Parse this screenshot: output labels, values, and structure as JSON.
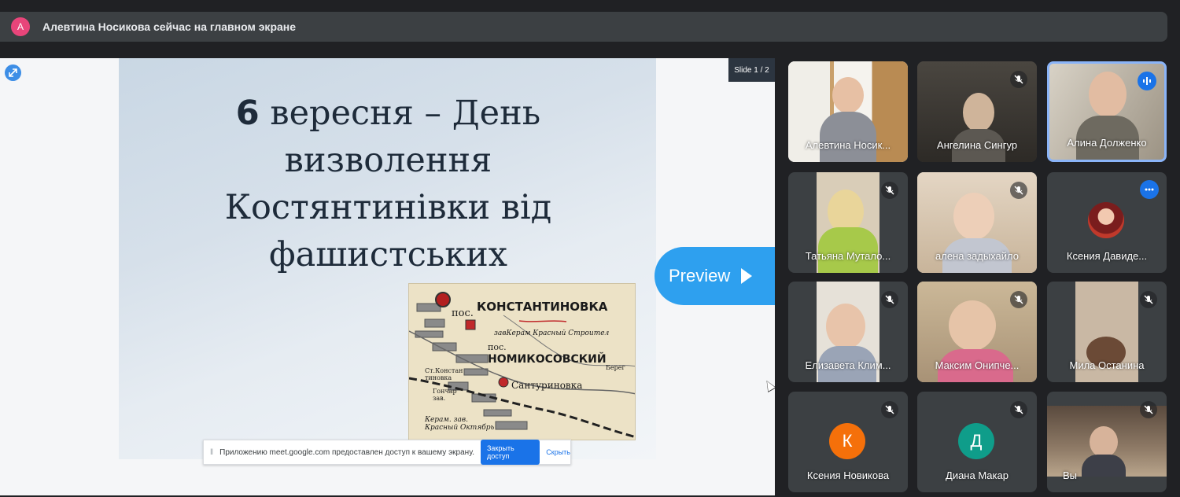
{
  "presenter_bar": {
    "avatar_letter": "А",
    "text": "Алевтина Носикова сейчас на главном экране"
  },
  "screen": {
    "slide_counter": "Slide 1 / 2",
    "slide": {
      "title_number": "6",
      "title_rest_line1": "вересня – День",
      "title_line2": "визволення",
      "title_line3": "Костянтинівки від",
      "title_line4": "фашистських"
    },
    "map_labels": {
      "posolok1": "пос.",
      "town": "КОНСТАНТИНОВКА",
      "line2": "завКерам Красный Строител",
      "posolok2": "пос.",
      "village": "НОМИКОСОВСКИЙ",
      "station": "Ст.Констан тиновка",
      "santurinovka": "Сантуриновка",
      "gonchar": "Гончар зав.",
      "keram": "Керам. зав. Красный Октябрь",
      "bereg": "Берег"
    },
    "preview_button": "Preview",
    "share_notice": {
      "message": "Приложению meet.google.com предоставлен доступ к вашему экрану.",
      "stop_button": "Закрыть доступ",
      "hide_link": "Скрыть"
    }
  },
  "participants": [
    {
      "name": "Алевтина Носик...",
      "muted": false,
      "speaking": false
    },
    {
      "name": "Ангелина Сингур",
      "muted": true,
      "speaking": false
    },
    {
      "name": "Алина Долженко",
      "muted": false,
      "speaking": true
    },
    {
      "name": "Татьяна Мутало...",
      "muted": true,
      "speaking": false
    },
    {
      "name": "алена задыхайло",
      "muted": true,
      "speaking": false
    },
    {
      "name": "Ксения Давиде...",
      "muted": false,
      "speaking": true
    },
    {
      "name": "Елизавета Клим...",
      "muted": true,
      "speaking": false
    },
    {
      "name": "Максим Онипче...",
      "muted": true,
      "speaking": false
    },
    {
      "name": "Мила Останина",
      "muted": true,
      "speaking": false
    },
    {
      "name": "Ксения Новикова",
      "muted": true,
      "speaking": false,
      "avatar_letter": "К",
      "avatar_color": "#f5700a"
    },
    {
      "name": "Диана Макар",
      "muted": true,
      "speaking": false,
      "avatar_letter": "Д",
      "avatar_color": "#0f9d8a"
    },
    {
      "name": "Вы",
      "muted": true,
      "speaking": false
    }
  ],
  "colors": {
    "background": "#202124",
    "accent_blue": "#1a73e8",
    "preview_blue": "#2ea0ef",
    "active_border": "#8ab4f8"
  }
}
